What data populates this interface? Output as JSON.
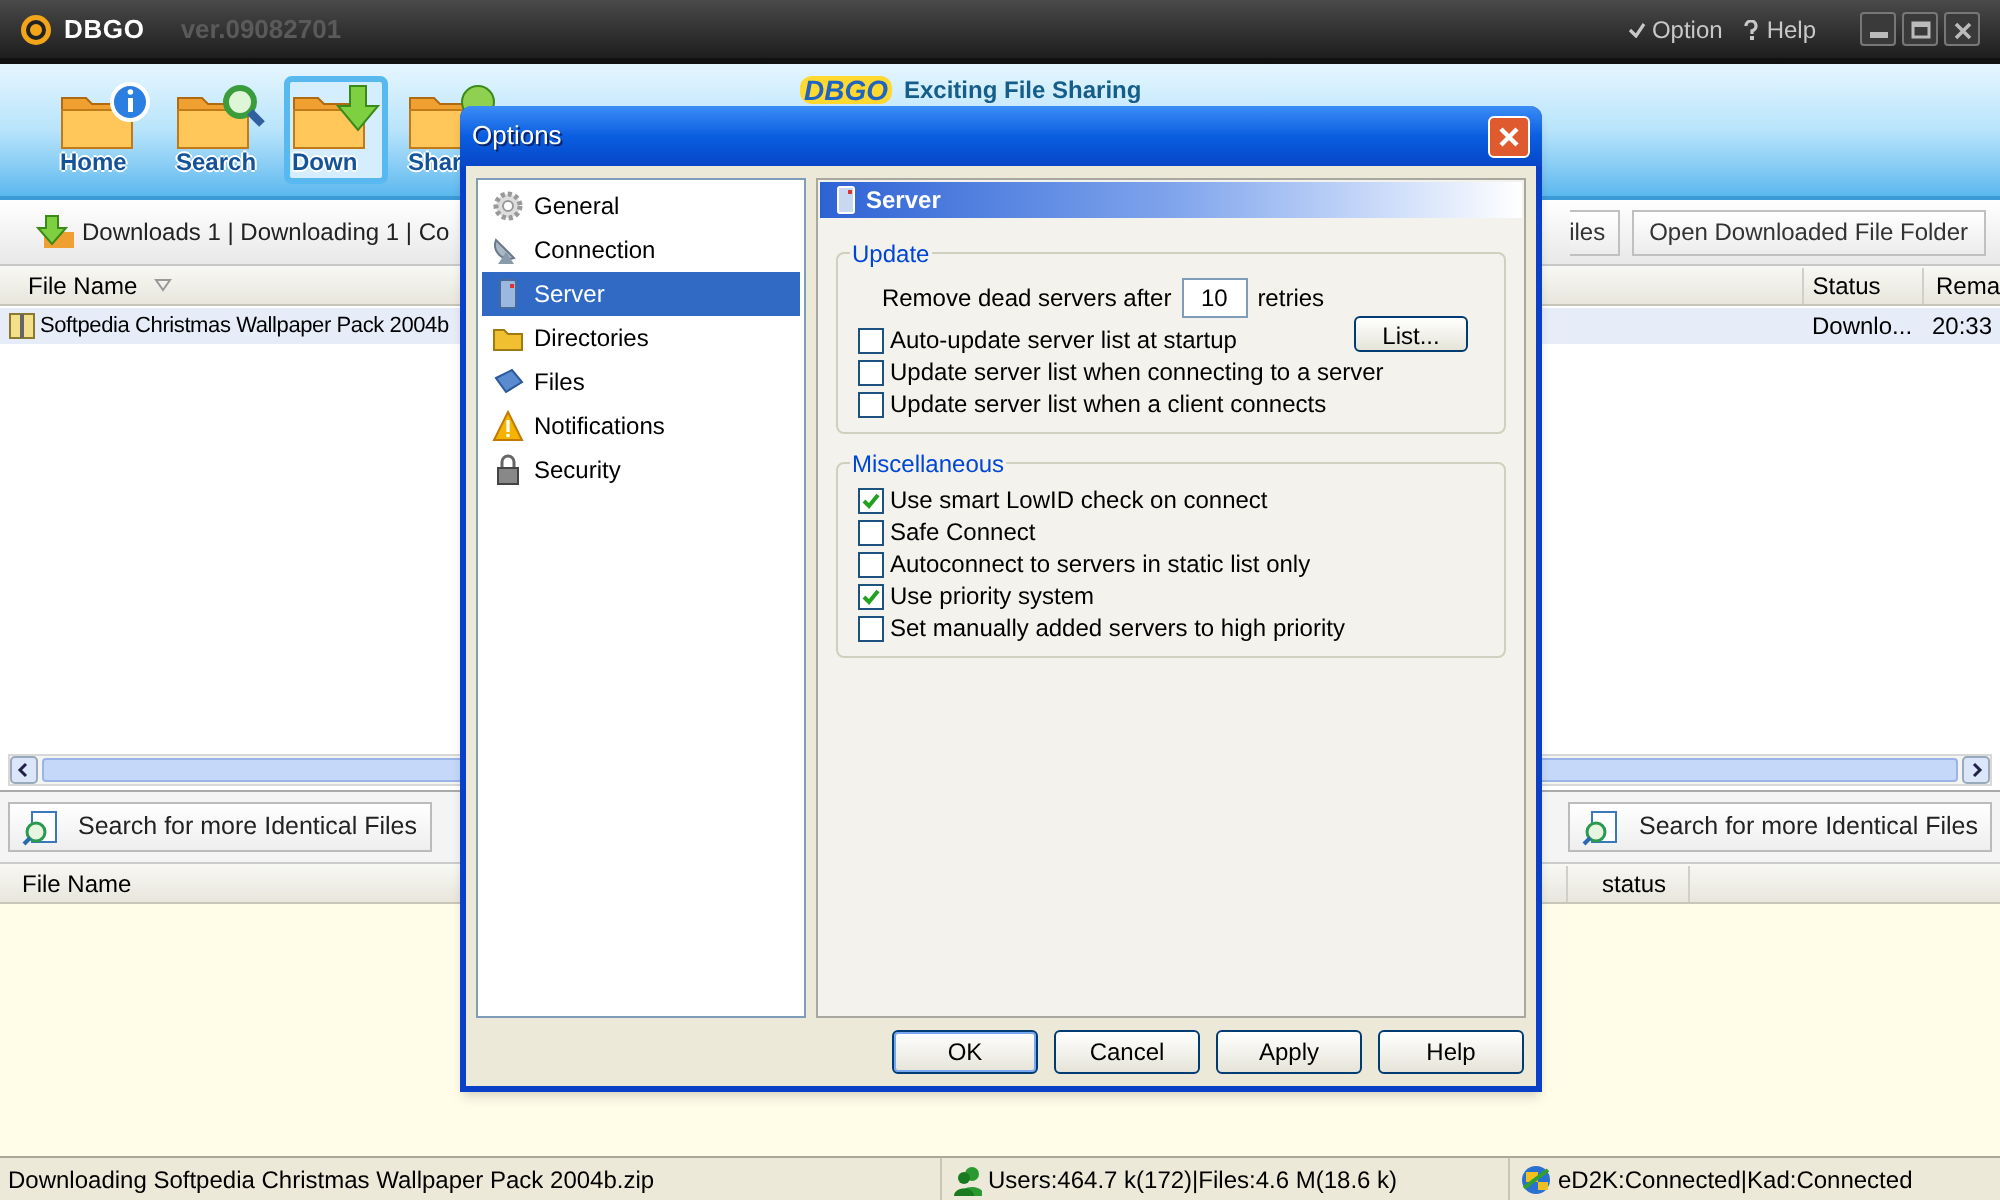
{
  "window": {
    "title": "DBGO",
    "version": "ver.09082701",
    "menu": [
      "Option",
      "Help"
    ]
  },
  "toolbar": [
    {
      "label": "Home",
      "selected": false
    },
    {
      "label": "Search",
      "selected": false
    },
    {
      "label": "Down",
      "selected": true
    },
    {
      "label": "Shar",
      "selected": false
    }
  ],
  "banner": {
    "logo": "DBGO",
    "slogan": "Exciting File Sharing"
  },
  "downloads_bar": {
    "summary": "Downloads 1 | Downloading 1 | Co",
    "buttons": [
      "iles",
      "Open Downloaded File Folder"
    ]
  },
  "downloads_table": {
    "columns": [
      "File Name",
      "Status",
      "Rema"
    ],
    "rows": [
      {
        "file": "Softpedia Christmas Wallpaper Pack 2004b",
        "status": "Downlo...",
        "remaining": "20:33",
        "selected": true
      }
    ]
  },
  "search_pane": {
    "buttons": [
      "Search for more Identical Files",
      "Search for more Identical Files"
    ],
    "columns": [
      "File Name",
      "status"
    ]
  },
  "status_bar": {
    "message": "Downloading Softpedia Christmas Wallpaper Pack 2004b.zip",
    "users": "Users:464.7 k(172)|Files:4.6 M(18.6 k)",
    "network": "eD2K:Connected|Kad:Connected"
  },
  "dialog": {
    "title": "Options",
    "nav": [
      {
        "label": "General",
        "selected": false
      },
      {
        "label": "Connection",
        "selected": false
      },
      {
        "label": "Server",
        "selected": true
      },
      {
        "label": "Directories",
        "selected": false
      },
      {
        "label": "Files",
        "selected": false
      },
      {
        "label": "Notifications",
        "selected": false
      },
      {
        "label": "Security",
        "selected": false
      }
    ],
    "panel_title": "Server",
    "groups": [
      {
        "title": "Update",
        "rows": [
          {
            "kind": "spin",
            "label": "Remove dead servers after",
            "value": "10",
            "suffix": "retries"
          },
          {
            "kind": "checkbox",
            "label": "Auto-update server list at startup",
            "checked": false,
            "button": "List..."
          },
          {
            "kind": "checkbox",
            "label": "Update server list when connecting to a server",
            "checked": false
          },
          {
            "kind": "checkbox",
            "label": "Update server list when a client connects",
            "checked": false
          }
        ]
      },
      {
        "title": "Miscellaneous",
        "rows": [
          {
            "kind": "checkbox",
            "label": "Use smart LowID check on connect",
            "checked": true
          },
          {
            "kind": "checkbox",
            "label": "Safe Connect",
            "checked": false
          },
          {
            "kind": "checkbox",
            "label": "Autoconnect to servers in static list only",
            "checked": false
          },
          {
            "kind": "checkbox",
            "label": "Use priority system",
            "checked": true
          },
          {
            "kind": "checkbox",
            "label": "Set manually added servers to high priority",
            "checked": false
          }
        ]
      }
    ],
    "buttons": [
      "OK",
      "Cancel",
      "Apply",
      "Help"
    ]
  }
}
